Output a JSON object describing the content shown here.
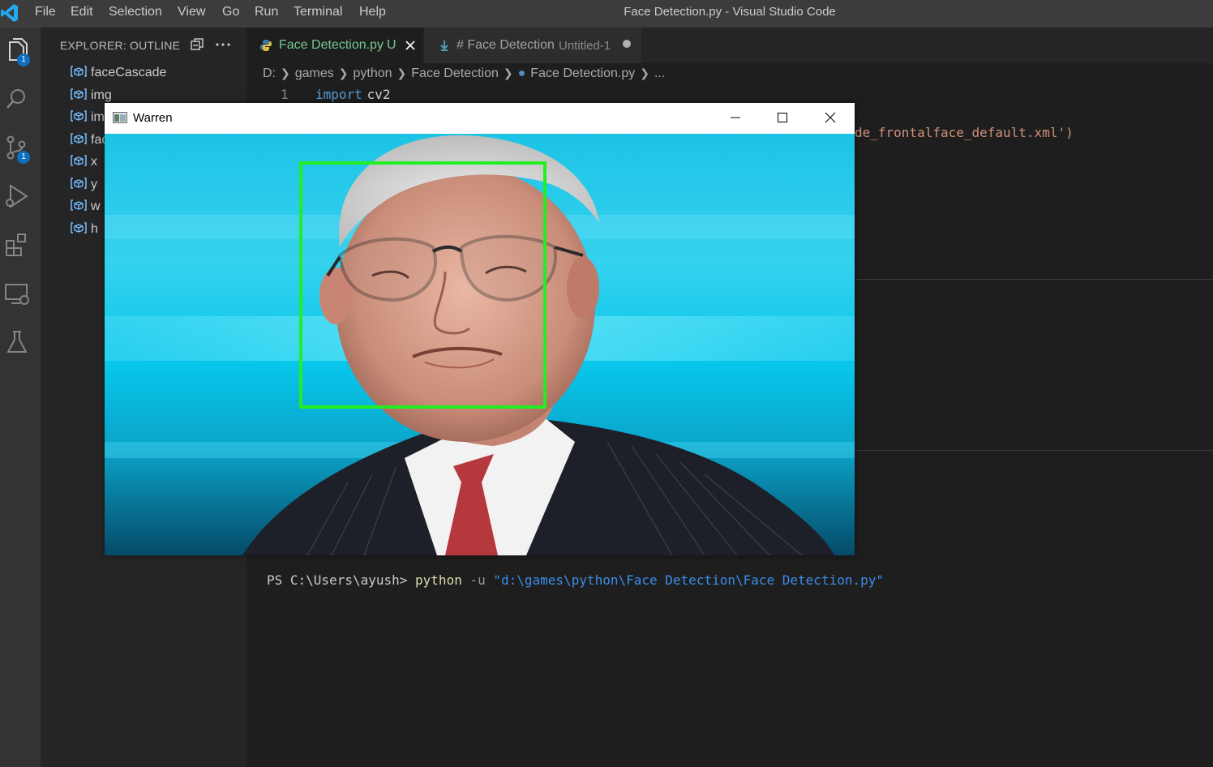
{
  "titlebar": {
    "menu": [
      "File",
      "Edit",
      "Selection",
      "View",
      "Go",
      "Run",
      "Terminal",
      "Help"
    ],
    "window_title": "Face Detection.py - Visual Studio Code"
  },
  "activitybar": {
    "icons": [
      "explorer-icon",
      "search-icon",
      "source-control-icon",
      "run-debug-icon",
      "extensions-icon",
      "remote-explorer-icon",
      "testing-icon"
    ],
    "explorer_badge": "1",
    "scm_badge": "1"
  },
  "sidebar": {
    "title": "EXPLORER: OUTLINE",
    "items": [
      "faceCascade",
      "img",
      "im",
      "fac",
      "x",
      "y",
      "w",
      "h"
    ]
  },
  "tabs": [
    {
      "label": "Face Detection.py",
      "status": "U",
      "active": true
    },
    {
      "label": "# Face Detection",
      "description": "Untitled-1",
      "dirty": true
    }
  ],
  "breadcrumb": [
    "D:",
    "games",
    "python",
    "Face Detection",
    "Face Detection.py",
    "..."
  ],
  "code": {
    "line1_number": "1",
    "line1_keyword": "import",
    "line1_rest": " cv2",
    "line3_fragment": "de_frontalface_default.xml')"
  },
  "terminal": {
    "prompt": "PS C:\\Users\\ayush> ",
    "command": "python",
    "flag": " -u ",
    "path": "\"d:\\games\\python\\Face Detection\\Face Detection.py\""
  },
  "cv_window": {
    "title": "Warren"
  },
  "colors": {
    "accent": "#0e70c0",
    "keyword": "#569cd6",
    "string": "#ce9178",
    "detection_box": "#22ee22"
  }
}
